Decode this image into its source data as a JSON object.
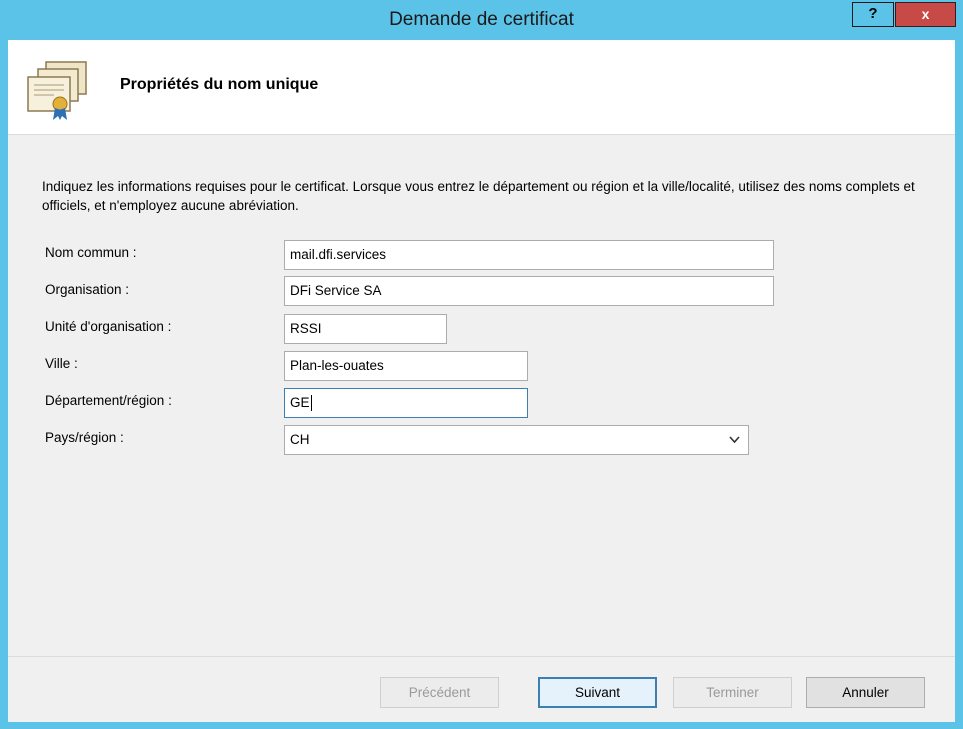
{
  "window": {
    "title": "Demande de certificat",
    "help_label": "?",
    "close_label": "x"
  },
  "header": {
    "title": "Propriétés du nom unique",
    "icon": "certificate-icon"
  },
  "description": "Indiquez les informations requises pour le certificat. Lorsque vous entrez le département ou région et la ville/localité, utilisez des noms complets et officiels, et n'employez aucune abréviation.",
  "form": {
    "common_name": {
      "label": "Nom commun :",
      "value": "mail.dfi.services"
    },
    "organization": {
      "label": "Organisation :",
      "value": "DFi Service SA"
    },
    "org_unit": {
      "label": "Unité d'organisation :",
      "value": "RSSI"
    },
    "city": {
      "label": "Ville :",
      "value": "Plan-les-ouates"
    },
    "state": {
      "label": "Département/région :",
      "value": "GE"
    },
    "country": {
      "label": "Pays/région :",
      "value": "CH",
      "icon": "chevron-down-icon"
    }
  },
  "buttons": {
    "previous": "Précédent",
    "next": "Suivant",
    "finish": "Terminer",
    "cancel": "Annuler"
  },
  "colors": {
    "titlebar": "#5bc3e8",
    "close": "#c74a46",
    "focus_border": "#3c7fb1"
  }
}
